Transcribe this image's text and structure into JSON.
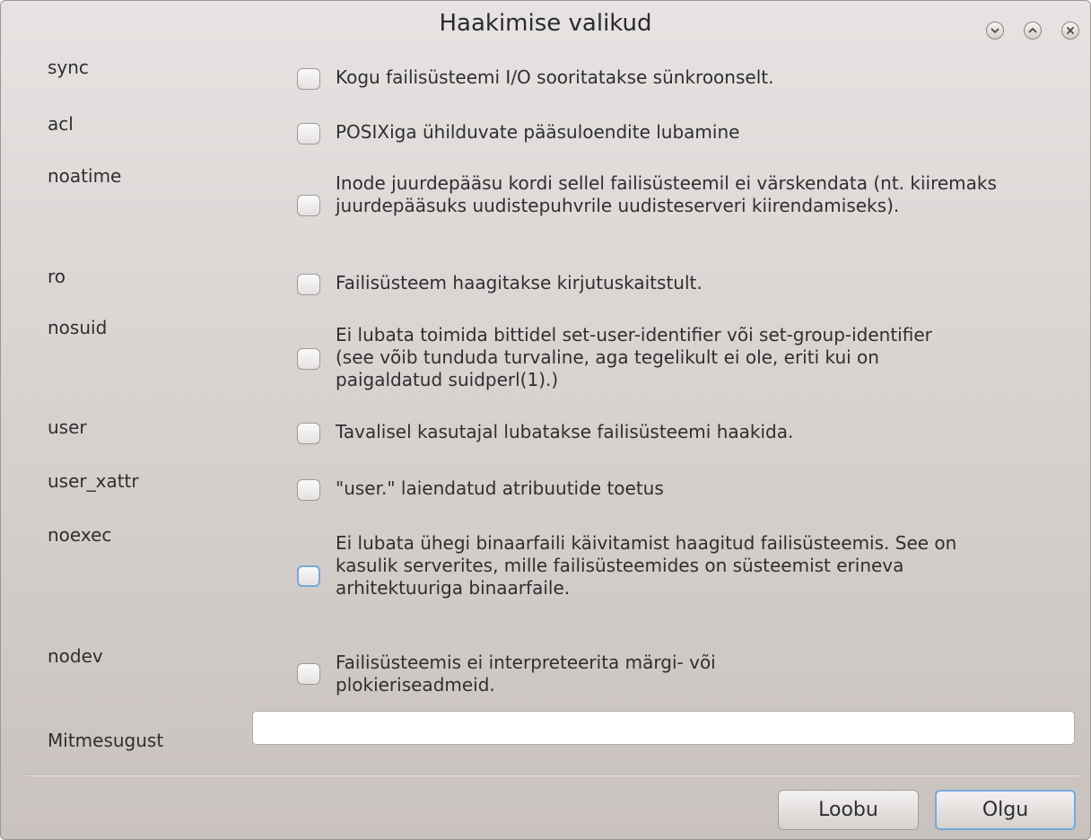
{
  "window": {
    "title": "Haakimise valikud"
  },
  "options": [
    {
      "key": "sync",
      "description": "Kogu failisüsteemi I/O sooritatakse sünkroonselt.",
      "checked": false
    },
    {
      "key": "acl",
      "description": "POSIXiga ühilduvate pääsuloendite lubamine",
      "checked": false
    },
    {
      "key": "noatime",
      "description": "Inode juurdepääsu kordi sellel failisüsteemil ei värskendata (nt. kiiremaks juurdepääsuks uudistepuhvrile uudisteserveri kiirendamiseks).",
      "checked": false
    },
    {
      "key": "ro",
      "description": "Failisüsteem haagitakse kirjutuskaitstult.",
      "checked": false
    },
    {
      "key": "nosuid",
      "description": "Ei lubata toimida bittidel set-user-identifier või set-group-identifier (see võib tunduda turvaline, aga tegelikult ei ole, eriti kui on paigaldatud suidperl(1).)",
      "checked": false
    },
    {
      "key": "user",
      "description": "Tavalisel kasutajal lubatakse failisüsteemi haakida.",
      "checked": false
    },
    {
      "key": "user_xattr",
      "description": "\"user.\" laiendatud atribuutide toetus",
      "checked": false
    },
    {
      "key": "noexec",
      "description": "Ei lubata ühegi binaarfaili käivitamist haagitud failisüsteemis. See on kasulik serverites, mille failisüsteemides on süsteemist erineva arhitektuuriga binaarfaile.",
      "checked": false
    },
    {
      "key": "nodev",
      "description": "Failisüsteemis ei interpreteerita märgi- või plokieriseadmeid.",
      "checked": false
    }
  ],
  "misc": {
    "label": "Mitmesugust",
    "value": ""
  },
  "buttons": {
    "cancel": "Loobu",
    "ok": "Olgu"
  },
  "icons": {
    "minimize": "chevron-down-icon",
    "maximize": "chevron-up-icon",
    "close": "close-icon"
  }
}
